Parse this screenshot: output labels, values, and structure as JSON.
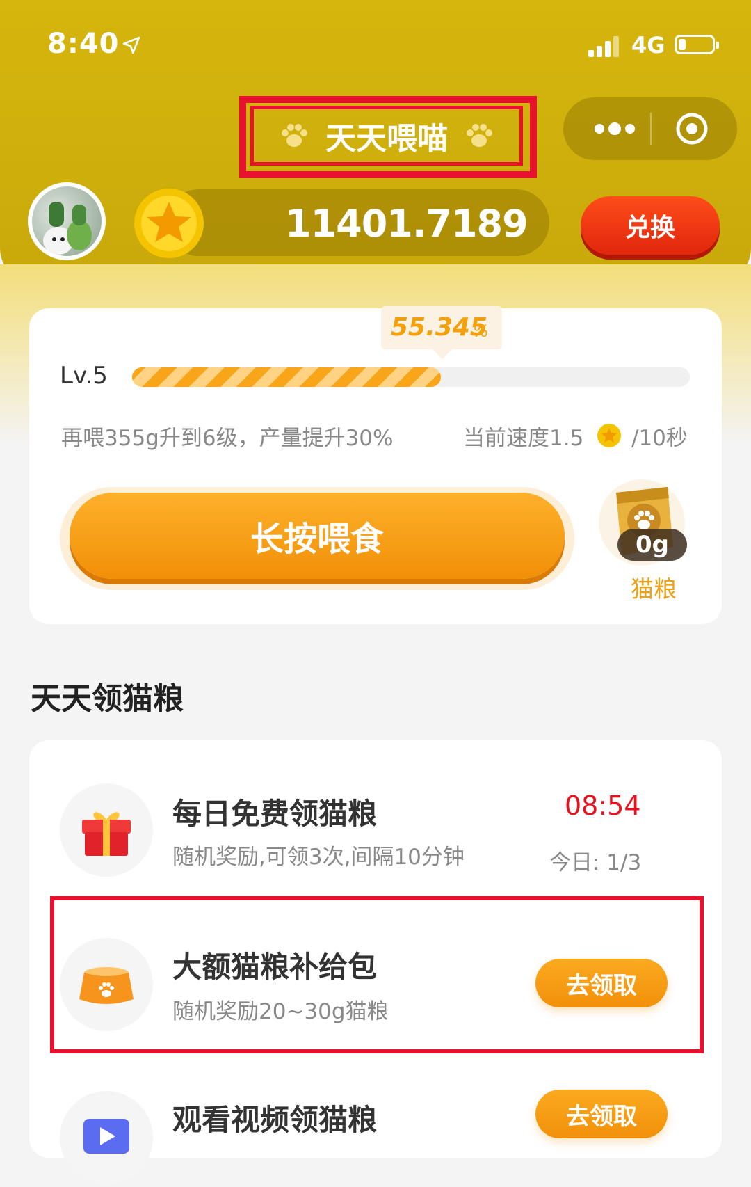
{
  "status_bar": {
    "time": "8:40",
    "network": "4G"
  },
  "header": {
    "title": "天天喂喵"
  },
  "wallet": {
    "balance": "11401.7189",
    "exchange_label": "兑换"
  },
  "level_card": {
    "progress_value": "55.345",
    "progress_unit": "%",
    "progress_fraction": 0.55345,
    "level": "Lv.5",
    "upgrade_hint": "再喂355g升到6级，产量提升30%",
    "speed_label": "当前速度1.5",
    "speed_unit": "/10秒",
    "feed_button": "长按喂食",
    "food_amount": "0g",
    "food_label": "猫粮"
  },
  "tasks_section": {
    "title": "天天领猫粮",
    "items": [
      {
        "title": "每日免费领猫粮",
        "desc": "随机奖励,可领3次,间隔10分钟",
        "countdown": "08:54",
        "today": "今日: 1/3",
        "icon": "gift-icon"
      },
      {
        "title": "大额猫粮补给包",
        "desc": "随机奖励20~30g猫粮",
        "button": "去领取",
        "icon": "cat-bowl-icon"
      },
      {
        "title": "观看视频领猫粮",
        "button": "去领取",
        "icon": "video-play-icon"
      }
    ]
  },
  "colors": {
    "header": "#d6b60c",
    "accent": "#f29008",
    "highlight": "#e6122e",
    "countdown": "#e8121e"
  }
}
